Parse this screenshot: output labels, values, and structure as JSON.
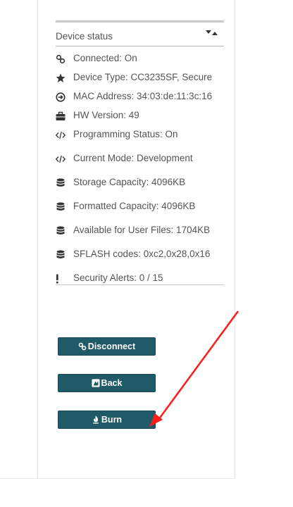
{
  "device_status": {
    "title": "Device status",
    "items": [
      {
        "icon": "link-icon",
        "label": "Connected: On"
      },
      {
        "icon": "star-icon",
        "label": "Device Type: CC3235SF, Secure"
      },
      {
        "icon": "arrow-circle-icon",
        "label": "MAC Address: 34:03:de:11:3c:16"
      },
      {
        "icon": "briefcase-icon",
        "label": "HW Version: 49"
      },
      {
        "icon": "code-icon",
        "label": "Programming Status: On"
      },
      {
        "icon": "code-icon",
        "label": "Current Mode: Development"
      },
      {
        "icon": "database-icon",
        "label": "Storage Capacity: 4096KB"
      },
      {
        "icon": "database-icon",
        "label": "Formatted Capacity: 4096KB"
      },
      {
        "icon": "database-icon",
        "label": "Available for User Files: 1704KB"
      },
      {
        "icon": "database-icon",
        "label": "SFLASH codes: 0xc2,0x28,0x16"
      },
      {
        "icon": "exclamation-icon",
        "label": "Security Alerts: 0 / 15"
      }
    ]
  },
  "buttons": {
    "disconnect": "Disconnect",
    "back": "Back",
    "burn": "Burn"
  },
  "colors": {
    "button_bg": "#1f5a66",
    "text": "#555555",
    "annotation_arrow": "#ff1a1a"
  }
}
